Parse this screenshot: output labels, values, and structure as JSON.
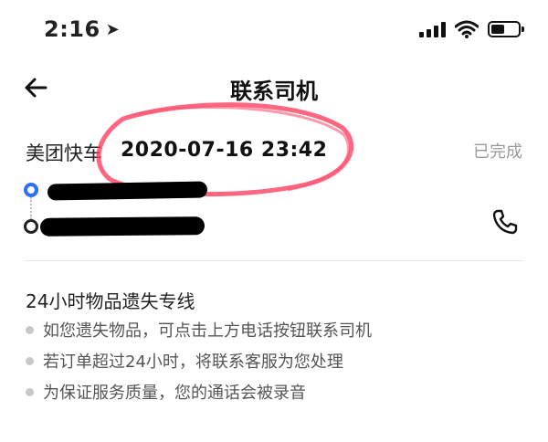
{
  "status_bar": {
    "time": "2:16",
    "location_icon": "location-arrow-icon",
    "signal_icon": "cellular-signal-icon",
    "wifi_icon": "wifi-icon",
    "battery_icon": "battery-icon",
    "battery_level": 0.45
  },
  "nav": {
    "back_icon": "back-arrow-icon",
    "title": "联系司机"
  },
  "order": {
    "service": "美团快车",
    "time": "2020-07-16 23:42",
    "status": "已完成",
    "phone_icon": "phone-icon"
  },
  "lost_items": {
    "title": "24小时物品遗失专线",
    "notes": [
      "如您遗失物品，可点击上方电话按钮联系司机",
      "若订单超过24小时，将联系客服为您处理",
      "为保证服务质量，您的通话会被录音"
    ]
  },
  "colors": {
    "accent": "#2f6ef7",
    "annotation": "#ff3355",
    "status_text": "#999999"
  }
}
